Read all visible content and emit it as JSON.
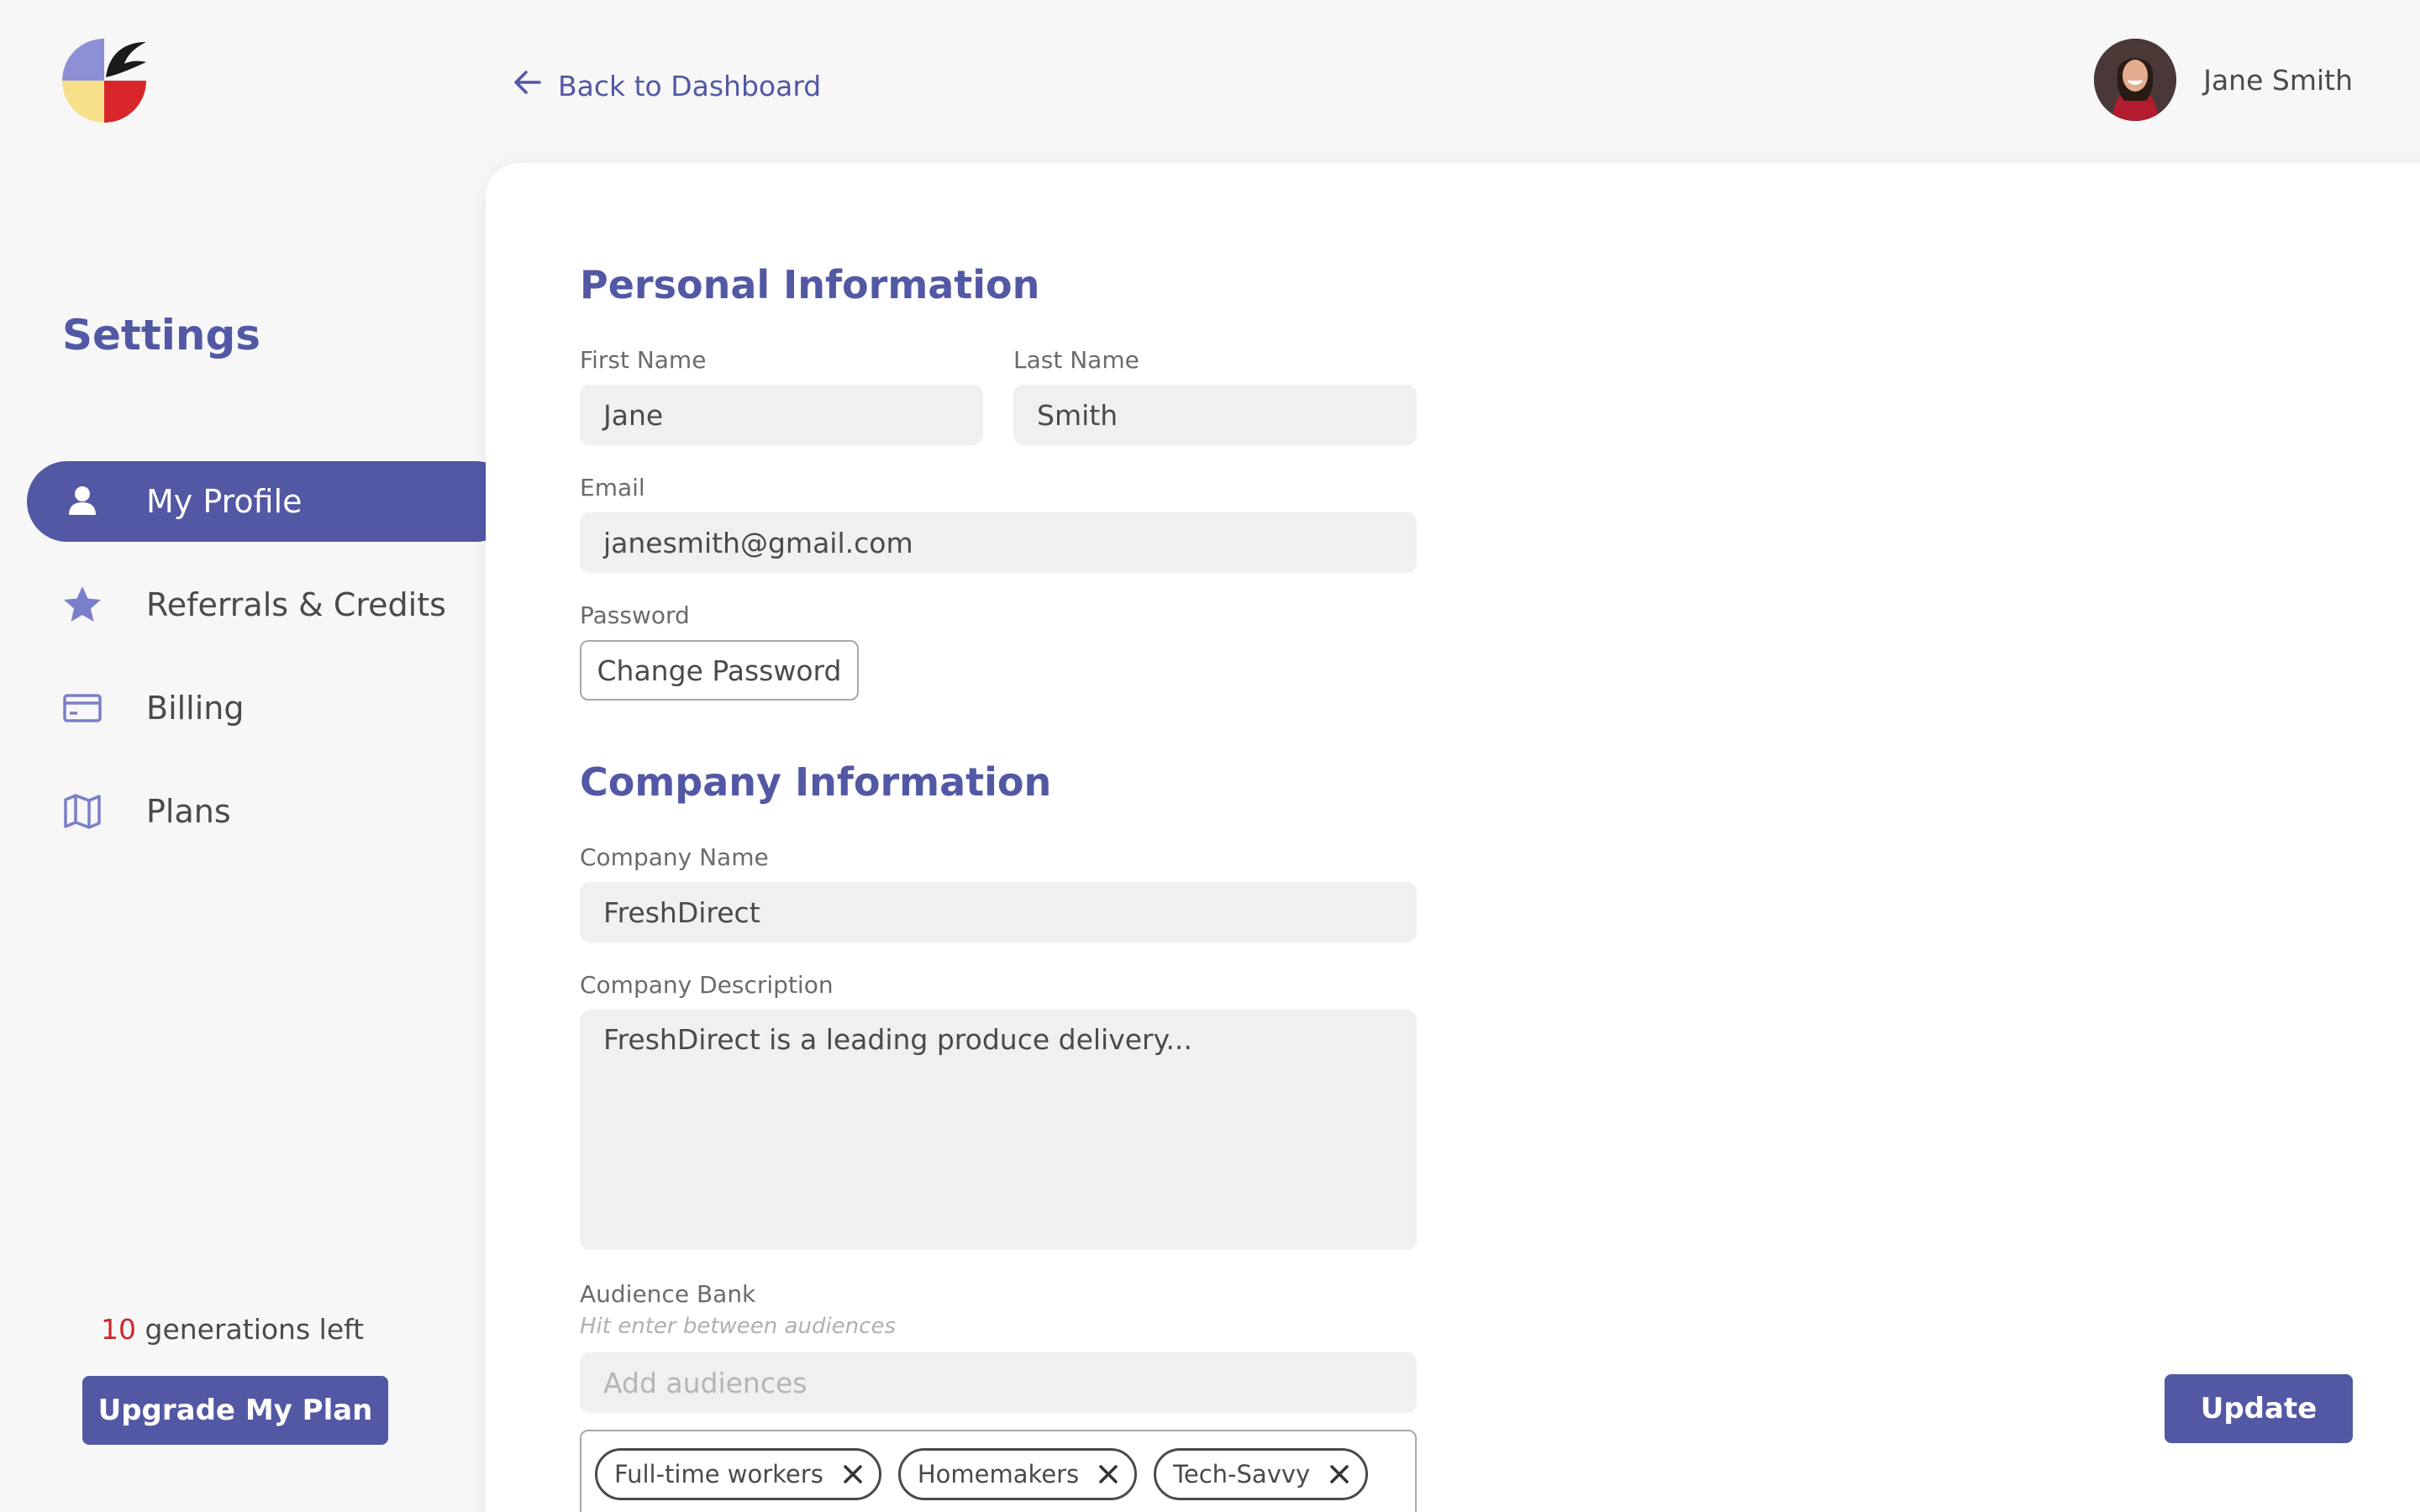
{
  "brand": {
    "logo_icon": "leaf-logo-icon",
    "accent_color": "#5258a4"
  },
  "header": {
    "back_label": "Back to Dashboard",
    "back_icon": "arrow-left-icon",
    "user_name": "Jane Smith"
  },
  "sidebar": {
    "title": "Settings",
    "items": [
      {
        "label": "My Profile",
        "icon": "user-icon",
        "active": true
      },
      {
        "label": "Referrals & Credits",
        "icon": "star-icon",
        "active": false
      },
      {
        "label": "Billing",
        "icon": "credit-card-icon",
        "active": false
      },
      {
        "label": "Plans",
        "icon": "map-icon",
        "active": false
      }
    ],
    "generations_count": "10",
    "generations_text": "generations left",
    "upgrade_label": "Upgrade My Plan"
  },
  "personal": {
    "title": "Personal Information",
    "first_name_label": "First Name",
    "first_name_value": "Jane",
    "last_name_label": "Last Name",
    "last_name_value": "Smith",
    "email_label": "Email",
    "email_value": "janesmith@gmail.com",
    "password_label": "Password",
    "change_password_label": "Change Password"
  },
  "company": {
    "title": "Company Information",
    "name_label": "Company Name",
    "name_value": "FreshDirect",
    "description_label": "Company Description",
    "description_value": "FreshDirect is a leading produce delivery...",
    "audience_label": "Audience Bank",
    "audience_hint": "Hit enter between audiences",
    "audience_placeholder": "Add audiences",
    "audiences": [
      "Full-time workers",
      "Homemakers",
      "Tech-Savvy"
    ]
  },
  "actions": {
    "update_label": "Update"
  }
}
